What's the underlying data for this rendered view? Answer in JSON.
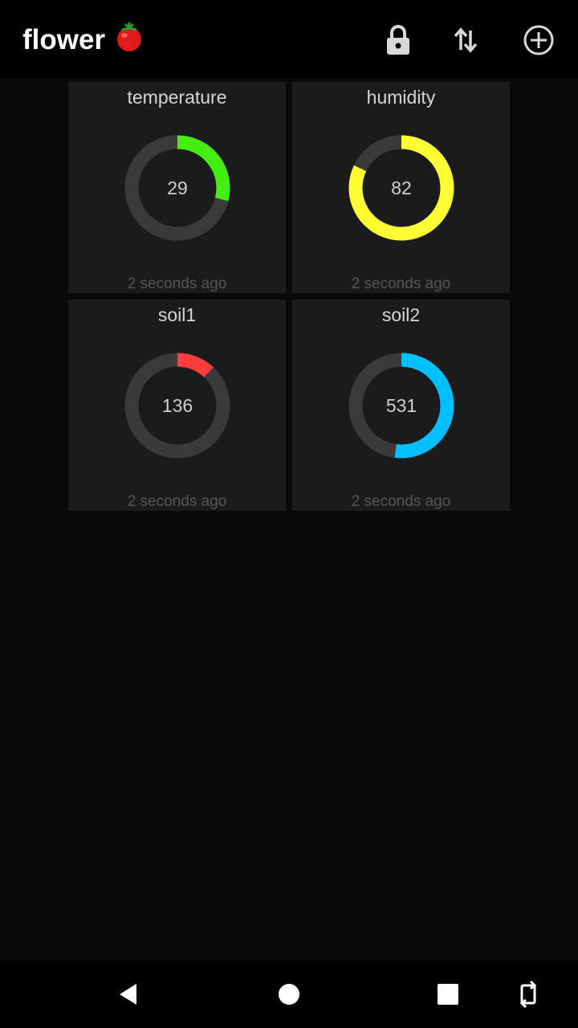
{
  "app": {
    "title": "flower",
    "title_emoji": "tomato-icon"
  },
  "toolbar": {
    "icons": [
      "lock-icon",
      "swap-vertical-icon",
      "add-circle-icon"
    ]
  },
  "tiles": [
    {
      "title": "temperature",
      "value": "29",
      "fraction": 0.29,
      "color": "#44ee11",
      "updated": "2 seconds ago"
    },
    {
      "title": "humidity",
      "value": "82",
      "fraction": 0.82,
      "color": "#ffff33",
      "updated": "2 seconds ago"
    },
    {
      "title": "soil1",
      "value": "136",
      "fraction": 0.12,
      "color": "#ff3b3b",
      "updated": "2 seconds ago"
    },
    {
      "title": "soil2",
      "value": "531",
      "fraction": 0.52,
      "color": "#00bfff",
      "updated": "2 seconds ago"
    }
  ],
  "navbar": {
    "icons": [
      "back-icon",
      "home-icon",
      "recents-icon",
      "rotate-icon"
    ]
  },
  "colors": {
    "track": "#3a3a3a",
    "tile_bg": "#1b1b1b",
    "app_bg": "#0a0a0a"
  }
}
